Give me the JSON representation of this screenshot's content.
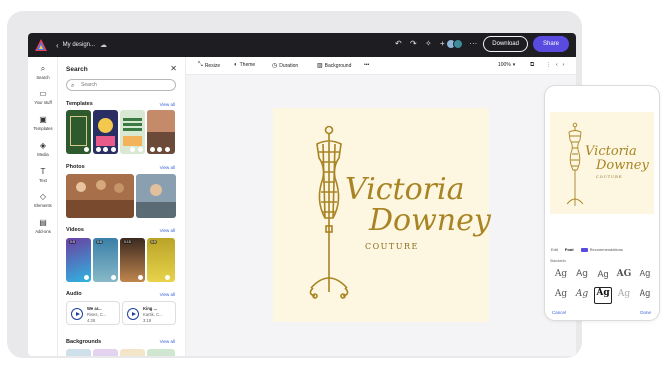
{
  "app": {
    "doc_title": "My design...",
    "download_label": "Download",
    "share_label": "Share",
    "accent_color": "#5a4be0"
  },
  "rail": {
    "items": [
      {
        "label": "Search",
        "icon": "search-icon"
      },
      {
        "label": "Your stuff",
        "icon": "folder-icon"
      },
      {
        "label": "Templates",
        "icon": "templates-icon"
      },
      {
        "label": "Media",
        "icon": "media-icon"
      },
      {
        "label": "Text",
        "icon": "text-icon"
      },
      {
        "label": "Elements",
        "icon": "elements-icon"
      },
      {
        "label": "Add-ons",
        "icon": "add-ons-icon"
      }
    ]
  },
  "panel": {
    "title": "Search",
    "search_placeholder": "Search",
    "view_all": "View all",
    "sections": {
      "templates": "Templates",
      "photos": "Photos",
      "videos": "Videos",
      "audio": "Audio",
      "backgrounds": "Backgrounds"
    },
    "video_tags": [
      "0:5",
      "0:5",
      "0:15",
      "0:5"
    ],
    "audio": [
      {
        "title": "We ar...",
        "artist": "Rises, C...",
        "duration": "4:28"
      },
      {
        "title": "King ...",
        "artist": "Kartik, C...",
        "duration": "3:18"
      }
    ]
  },
  "toolbar": {
    "resize": "Resize",
    "theme": "Theme",
    "duration": "Duration",
    "background": "Background",
    "more": "•••",
    "zoom": "100%"
  },
  "design": {
    "line1": "Victoria",
    "line2": "Downey",
    "line3": "COUTURE",
    "gold": "#a88424"
  },
  "phone": {
    "tabs": [
      "Edit",
      "Font",
      "Recommendations"
    ],
    "caption": "Standards",
    "fonts": [
      "Ag",
      "Ag",
      "Ag",
      "AG",
      "Ag",
      "Ag",
      "Ag",
      "Ag",
      "Ag",
      "Ag"
    ],
    "cancel": "Cancel",
    "done": "Done"
  }
}
